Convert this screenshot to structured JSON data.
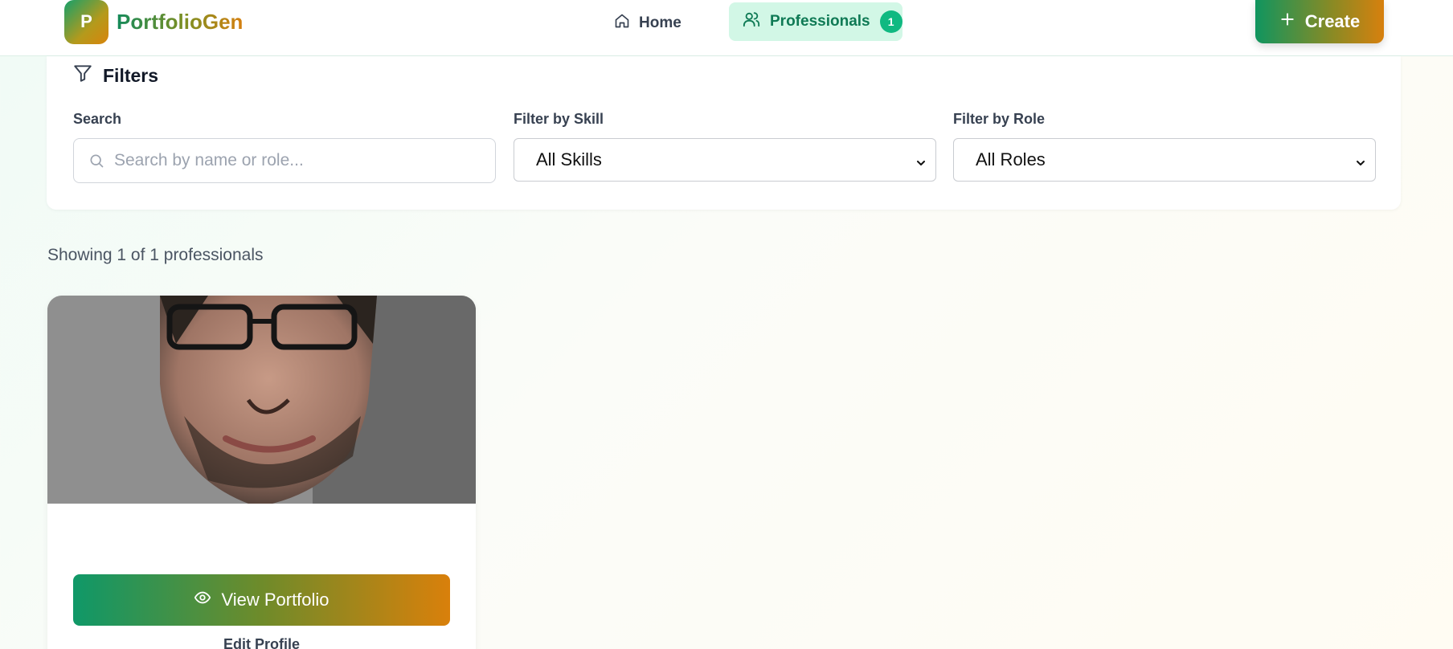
{
  "brand": {
    "logo_letter": "P",
    "name": "PortfolioGen"
  },
  "nav": {
    "home_label": "Home",
    "professionals_label": "Professionals",
    "professionals_count": "1"
  },
  "header": {
    "create_label": "Create"
  },
  "filters": {
    "title": "Filters",
    "search_label": "Search",
    "search_placeholder": "Search by name or role...",
    "search_value": "",
    "skill_label": "Filter by Skill",
    "skill_value": "All Skills",
    "role_label": "Filter by Role",
    "role_value": "All Roles"
  },
  "results": {
    "count_text": "Showing 1 of 1 professionals"
  },
  "card": {
    "view_label": "View Portfolio",
    "edit_label": "Edit Profile"
  },
  "colors": {
    "brand_green": "#10955f",
    "brand_orange": "#d7800e",
    "active_nav_bg": "#d2f7e6",
    "badge": "#10b981"
  },
  "icons": [
    "home-icon",
    "users-icon",
    "plus-icon",
    "filter-icon",
    "search-icon",
    "chevron-down-icon",
    "eye-icon"
  ]
}
